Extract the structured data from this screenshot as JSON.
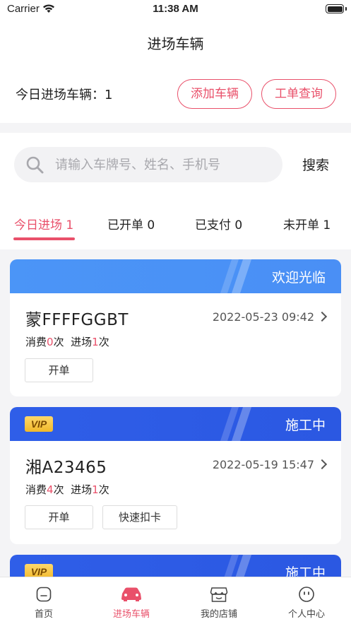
{
  "status_bar": {
    "carrier": "Carrier",
    "time": "11:38 AM"
  },
  "nav": {
    "title": "进场车辆"
  },
  "summary": {
    "label": "今日进场车辆：1",
    "add_button": "添加车辆",
    "query_button": "工单查询"
  },
  "search": {
    "placeholder": "请输入车牌号、姓名、手机号",
    "button": "搜索"
  },
  "tabs": [
    {
      "label": "今日进场 1",
      "active": true
    },
    {
      "label": "已开单 0",
      "active": false
    },
    {
      "label": "已支付 0",
      "active": false
    },
    {
      "label": "未开单 1",
      "active": false
    }
  ],
  "cards": [
    {
      "status": "欢迎光临",
      "plate": "蒙FFFFGGBT",
      "datetime": "2022-05-23 09:42",
      "consume_label": "消费",
      "consume_count": "0",
      "consume_unit": "次",
      "entry_label": "进场",
      "entry_count": "1",
      "entry_unit": "次",
      "actions": [
        "开单"
      ]
    },
    {
      "badge": "VIP",
      "status": "施工中",
      "plate": "湘A23465",
      "datetime": "2022-05-19 15:47",
      "consume_label": "消费",
      "consume_count": "4",
      "consume_unit": "次",
      "entry_label": "进场",
      "entry_count": "1",
      "entry_unit": "次",
      "actions": [
        "开单",
        "快速扣卡"
      ]
    },
    {
      "badge": "VIP",
      "status": "施工中"
    }
  ],
  "tabbar": [
    {
      "label": "首页",
      "icon": "home-icon",
      "active": false
    },
    {
      "label": "进场车辆",
      "icon": "car-icon",
      "active": true
    },
    {
      "label": "我的店铺",
      "icon": "store-icon",
      "active": false
    },
    {
      "label": "个人中心",
      "icon": "profile-icon",
      "active": false
    }
  ],
  "colors": {
    "accent": "#e9506a",
    "card_head_blue": "#4b95f7",
    "card_head_dark": "#2f5ee8",
    "vip_gold": "#f0b82a"
  }
}
